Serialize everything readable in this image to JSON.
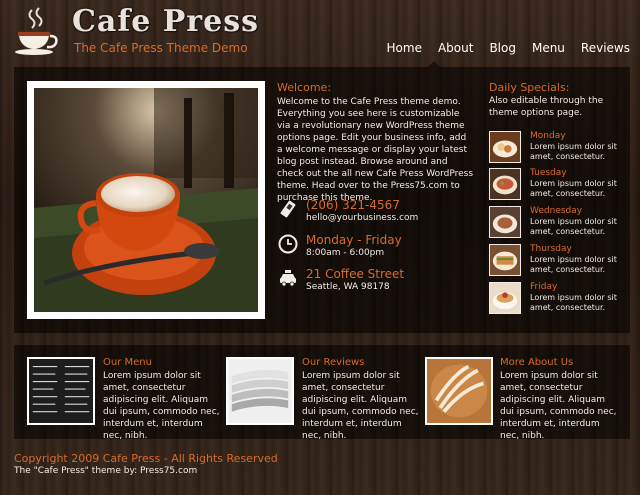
{
  "header": {
    "site_title": "Cafe Press",
    "tagline": "The Cafe Press Theme Demo",
    "nav": [
      "Home",
      "About",
      "Blog",
      "Menu",
      "Reviews"
    ]
  },
  "welcome": {
    "title": "Welcome:",
    "text": "Welcome to the Cafe Press theme demo. Everything you see here is customizable via a revolutionary new WordPress theme options page. Edit your business info, add a welcome message or display your latest blog post instead. Browse around and check out the all new Cafe Press WordPress theme. Head over to the Press75.com to purchase this theme."
  },
  "contact": {
    "phone": "(206) 321-4567",
    "email": "hello@yourbusiness.com",
    "hours_title": "Monday - Friday",
    "hours": "8:00am - 6:00pm",
    "street": "21 Coffee Street",
    "city": "Seattle, WA 98178"
  },
  "specials": {
    "title": "Daily Specials:",
    "subtitle": "Also editable through the theme options page.",
    "items": [
      {
        "day": "Monday",
        "desc": "Lorem ipsum dolor sit amet, consectetur."
      },
      {
        "day": "Tuesday",
        "desc": "Lorem ipsum dolor sit amet, consectetur."
      },
      {
        "day": "Wednesday",
        "desc": "Lorem ipsum dolor sit amet, consectetur."
      },
      {
        "day": "Thursday",
        "desc": "Lorem ipsum dolor sit amet, consectetur."
      },
      {
        "day": "Friday",
        "desc": "Lorem ipsum dolor sit amet, consectetur."
      }
    ]
  },
  "features": [
    {
      "title": "Our Menu",
      "text": "Lorem ipsum dolor sit amet, consectetur adipiscing elit. Aliquam dui ipsum, commodo nec, interdum et, interdum nec, nibh."
    },
    {
      "title": "Our Reviews",
      "text": "Lorem ipsum dolor sit amet, consectetur adipiscing elit. Aliquam dui ipsum, commodo nec, interdum et, interdum nec, nibh."
    },
    {
      "title": "More About Us",
      "text": "Lorem ipsum dolor sit amet, consectetur adipiscing elit. Aliquam dui ipsum, commodo nec, interdum et, interdum nec, nibh."
    }
  ],
  "footer": {
    "copyright": "Copyright 2009 Cafe Press - All Rights Reserved",
    "credit": "The \"Cafe Press\" theme by: Press75.com"
  },
  "colors": {
    "accent": "#d86a2e",
    "text": "#f2ece6",
    "panel": "#000000"
  },
  "icons": [
    "coffee-cup-logo-icon",
    "phone-icon",
    "clock-icon",
    "taxi-icon"
  ]
}
